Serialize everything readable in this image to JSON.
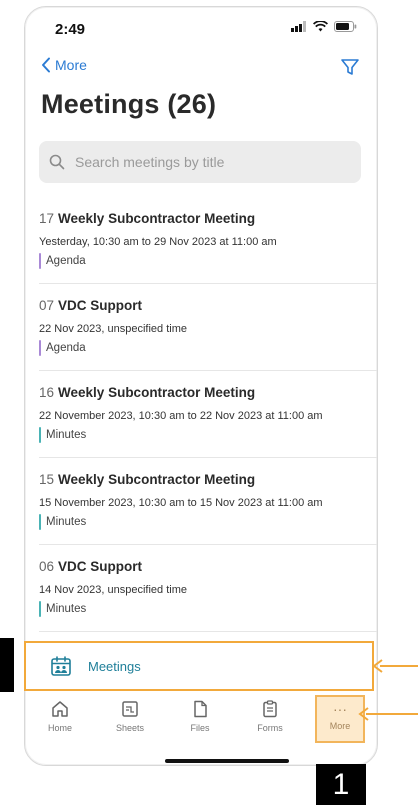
{
  "status_bar": {
    "time": "2:49"
  },
  "nav": {
    "back_label": "More"
  },
  "page": {
    "title": "Meetings (26)"
  },
  "search": {
    "placeholder": "Search meetings by title"
  },
  "meetings": [
    {
      "number": "17",
      "name": "Weekly Subcontractor Meeting",
      "date": "Yesterday, 10:30 am to 29 Nov 2023 at 11:00 am",
      "tag": "Agenda",
      "tag_color": "#a989d6"
    },
    {
      "number": "07",
      "name": "VDC Support",
      "date": "22 Nov 2023, unspecified time",
      "tag": "Agenda",
      "tag_color": "#a989d6"
    },
    {
      "number": "16",
      "name": "Weekly Subcontractor Meeting",
      "date": "22 November 2023, 10:30 am to 22 Nov 2023 at 11:00 am",
      "tag": "Minutes",
      "tag_color": "#4ab3b5"
    },
    {
      "number": "15",
      "name": "Weekly Subcontractor Meeting",
      "date": "15 November 2023, 10:30 am to 15 Nov 2023 at 11:00 am",
      "tag": "Minutes",
      "tag_color": "#4ab3b5"
    },
    {
      "number": "06",
      "name": "VDC Support",
      "date": "14 Nov 2023, unspecified time",
      "tag": "Minutes",
      "tag_color": "#4ab3b5"
    }
  ],
  "meetings_bar": {
    "label": "Meetings",
    "icon": "meetings-calendar-icon"
  },
  "tabs": [
    {
      "label": "Home",
      "icon": "home-icon"
    },
    {
      "label": "Sheets",
      "icon": "sheets-icon"
    },
    {
      "label": "Files",
      "icon": "file-icon"
    },
    {
      "label": "Forms",
      "icon": "clipboard-icon"
    },
    {
      "label": "More",
      "icon": "more-icon",
      "dots": "···"
    }
  ],
  "annotation": {
    "step": "1",
    "highlight_color": "#f2a93b"
  }
}
